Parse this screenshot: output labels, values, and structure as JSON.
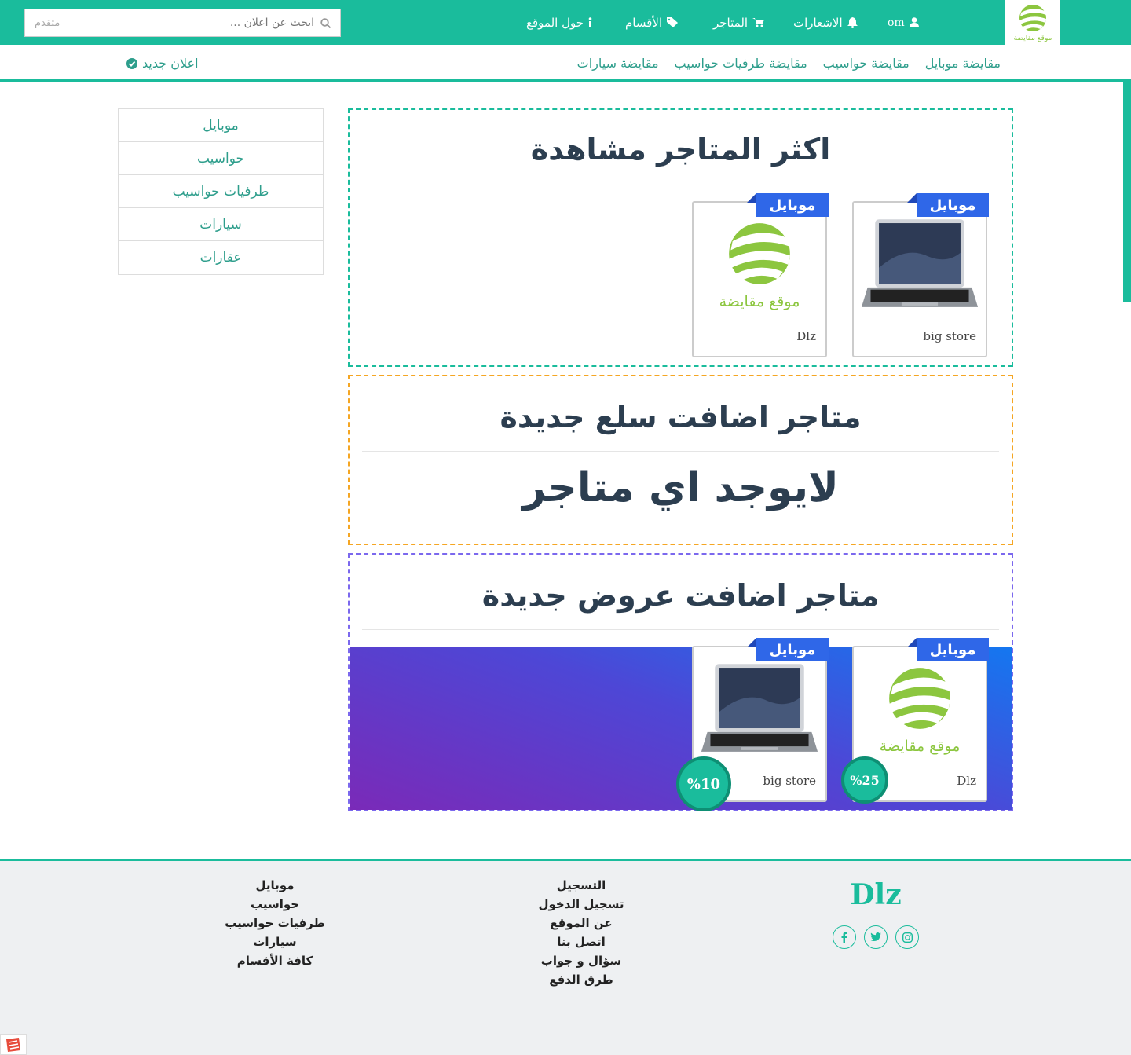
{
  "header": {
    "logo_caption": "موقع مقايضة",
    "nav": {
      "user": "om",
      "notifications": "الاشعارات",
      "stores": "المتاجر",
      "sections": "الأقسام",
      "about": "حول الموقع"
    },
    "search": {
      "placeholder": "ابحث عن اعلان ...",
      "advanced": "متقدم"
    }
  },
  "subnav": {
    "categories": [
      "مقايضة موبايل",
      "مقايضة حواسيب",
      "مقايضة طرفيات حواسيب",
      "مقايضة سيارات"
    ],
    "new_ad": "اعلان جديد"
  },
  "sidebar": {
    "items": [
      "موبايل",
      "حواسيب",
      "طرفيات حواسيب",
      "سيارات",
      "عقارات"
    ]
  },
  "sections": {
    "most_viewed": {
      "title": "اكثر المتاجر مشاهدة",
      "cards": [
        {
          "ribbon": "موبايل",
          "name": "big store",
          "image": "laptop"
        },
        {
          "ribbon": "موبايل",
          "name": "Dlz",
          "image": "logo",
          "logo_caption": "موقع مقايضة"
        }
      ]
    },
    "new_items": {
      "title": "متاجر اضافت سلع جديدة",
      "empty": "لايوجد اي متاجر"
    },
    "new_offers": {
      "title": "متاجر اضافت عروض جديدة",
      "cards": [
        {
          "ribbon": "موبايل",
          "name": "Dlz",
          "image": "logo",
          "logo_caption": "موقع مقايضة",
          "discount": "%25"
        },
        {
          "ribbon": "موبايل",
          "name": "big store",
          "image": "laptop",
          "discount": "%10"
        }
      ]
    }
  },
  "footer": {
    "brand": "Dlz",
    "links_col1": [
      "التسجيل",
      "تسجيل الدخول",
      "عن الموقع",
      "اتصل بنا",
      "سؤال و جواب",
      "طرق الدفع"
    ],
    "links_col2": [
      "موبايل",
      "حواسيب",
      "طرفيات حواسيب",
      "سيارات",
      "كافة الأقسام"
    ],
    "socials": [
      "facebook-icon",
      "twitter-icon",
      "instagram-icon"
    ]
  },
  "colors": {
    "primary": "#1abc9c",
    "ribbon": "#2f67e8",
    "panel1": "#1abc9c",
    "panel2": "#f5a623",
    "panel3": "#7b68ee"
  }
}
